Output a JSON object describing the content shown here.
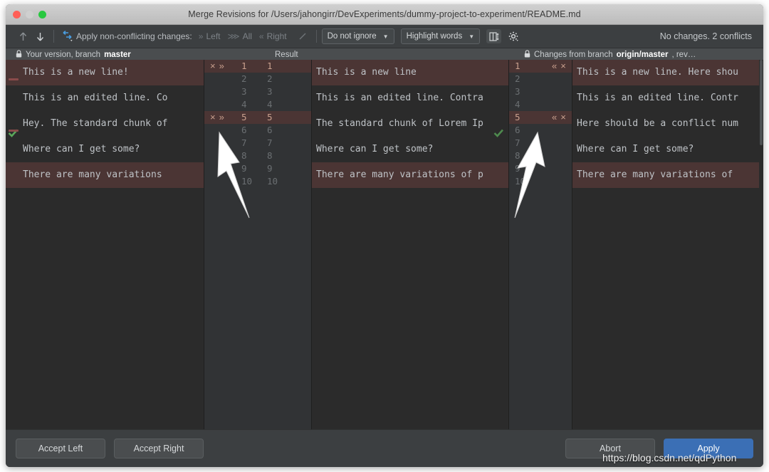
{
  "window": {
    "title": "Merge Revisions for /Users/jahongirr/DevExperiments/dummy-project-to-experiment/README.md",
    "traffic_lights": [
      "close-red",
      "minimize-gray",
      "maximize-green"
    ]
  },
  "toolbar": {
    "prev_icon": "arrow-up-icon",
    "next_icon": "arrow-down-icon",
    "apply_icon": "apply-changes-icon",
    "apply_label": "Apply non-conflicting changes:",
    "apply_left": "Left",
    "apply_all": "All",
    "apply_right": "Right",
    "edit_icon": "pencil-icon",
    "ignore_policy": "Do not ignore",
    "highlight_policy": "Highlight words",
    "collapse_icon": "collapse-unchanged-icon",
    "settings_icon": "gear-icon",
    "status": "No changes. 2 conflicts"
  },
  "panes": {
    "left_header_prefix": "Your version, branch",
    "left_header_branch": "master",
    "result_header": "Result",
    "right_header_prefix": "Changes from branch",
    "right_header_branch": "origin/master",
    "right_header_suffix": ", rev…",
    "lock_icon": "lock-icon"
  },
  "left_lines": [
    "This is a new line!",
    "This is an edited line. Co",
    "Hey. The standard chunk of",
    "Where can I get some?",
    "There are many variations"
  ],
  "result_lines": [
    "This is a new line",
    "This is an edited line. Contra",
    "The standard chunk of Lorem Ip",
    "Where can I get some?",
    "There are many variations of p"
  ],
  "right_lines": [
    "This is a new line. Here shou",
    "This is an edited line. Contr",
    "Here should be a conflict num",
    "Where can I get some?",
    "There are many variations of"
  ],
  "line_numbers": [
    "1",
    "2",
    "3",
    "4",
    "5",
    "6",
    "7",
    "8",
    "9",
    "10"
  ],
  "conflict_rows": [
    0,
    4
  ],
  "gutter_actions": {
    "left_accept": "»",
    "left_reject": "×",
    "right_accept": "«",
    "right_reject": "×"
  },
  "bottom": {
    "accept_left": "Accept Left",
    "accept_right": "Accept Right",
    "abort": "Abort",
    "apply": "Apply"
  },
  "watermark": "https://blog.csdn.net/qdPython",
  "colors": {
    "conflict_bg": "#4b3534",
    "accent_blue": "#3b6fb5",
    "check_green": "#4e9a4e",
    "window_bg": "#3c3f41",
    "editor_bg": "#2b2b2b"
  }
}
